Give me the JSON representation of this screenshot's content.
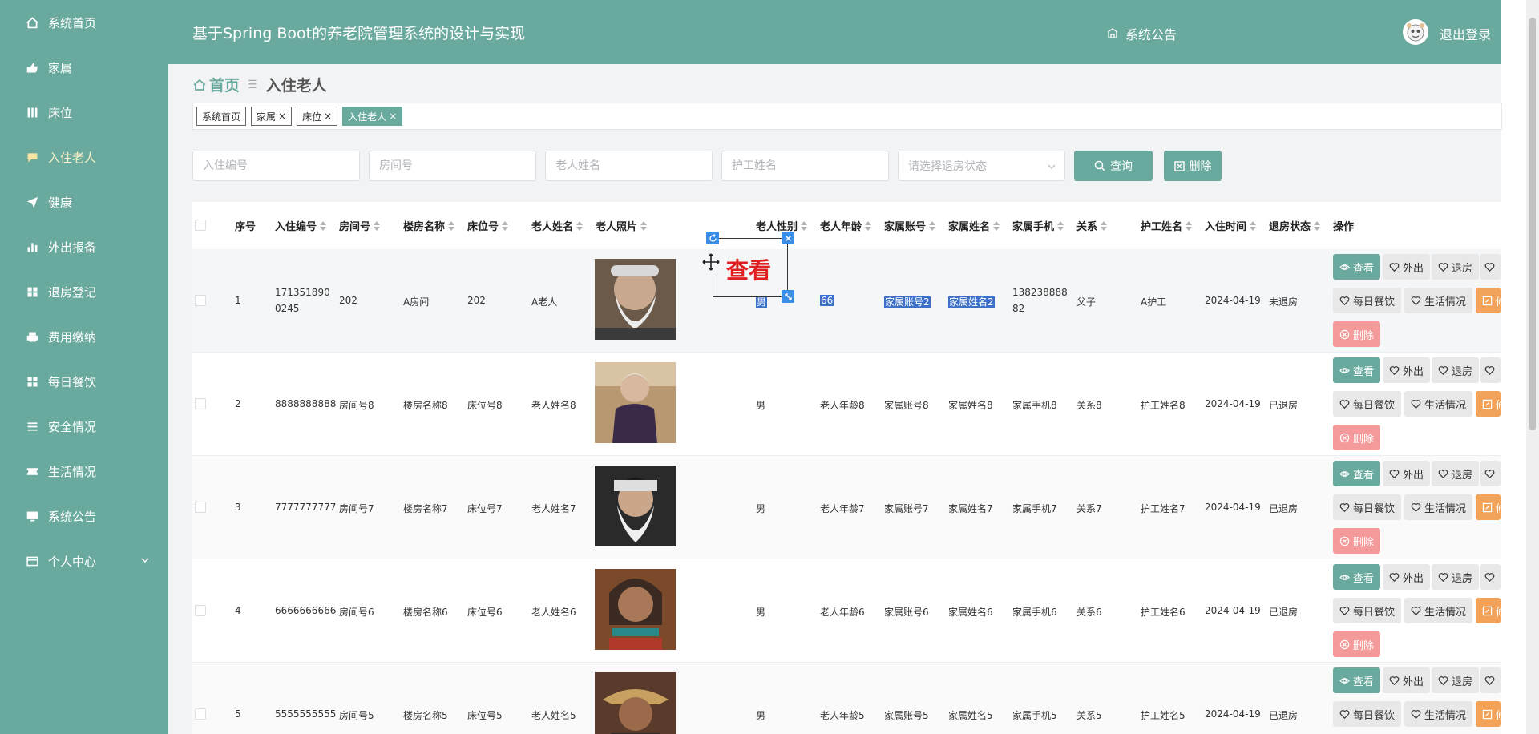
{
  "sidebar": {
    "items": [
      {
        "label": "系统首页",
        "icon": "home-icon"
      },
      {
        "label": "家属",
        "icon": "thumbs-up-icon"
      },
      {
        "label": "床位",
        "icon": "bars-icon"
      },
      {
        "label": "入住老人",
        "icon": "chat-icon"
      },
      {
        "label": "健康",
        "icon": "paper-plane-icon"
      },
      {
        "label": "外出报备",
        "icon": "chart-icon"
      },
      {
        "label": "退房登记",
        "icon": "grid-icon"
      },
      {
        "label": "费用缴纳",
        "icon": "printer-icon"
      },
      {
        "label": "每日餐饮",
        "icon": "grid-icon"
      },
      {
        "label": "安全情况",
        "icon": "list-icon"
      },
      {
        "label": "生活情况",
        "icon": "ticket-icon"
      },
      {
        "label": "系统公告",
        "icon": "monitor-icon"
      },
      {
        "label": "个人中心",
        "icon": "card-icon"
      }
    ]
  },
  "header": {
    "title": "基于Spring Boot的养老院管理系统的设计与实现",
    "notice": "系统公告",
    "logout": "退出登录"
  },
  "breadcrumb": {
    "home": "首页",
    "current": "入住老人"
  },
  "tags": [
    {
      "label": "系统首页",
      "closable": false
    },
    {
      "label": "家属",
      "closable": true
    },
    {
      "label": "床位",
      "closable": true
    },
    {
      "label": "入住老人",
      "closable": true
    }
  ],
  "tag_close": "×",
  "search": {
    "placeholders": [
      "入住编号",
      "房间号",
      "老人姓名",
      "护工姓名"
    ],
    "select_placeholder": "请选择退房状态",
    "query": "查询",
    "delete": "删除"
  },
  "table": {
    "headers": [
      "序号",
      "入住编号",
      "房间号",
      "楼房名称",
      "床位号",
      "老人姓名",
      "老人照片",
      "老人性别",
      "老人年龄",
      "家属账号",
      "家属姓名",
      "家属手机",
      "关系",
      "护工姓名",
      "入住时间",
      "退房状态",
      "操作"
    ],
    "rows": [
      {
        "no": "1",
        "code": "1713518900245",
        "room": "202",
        "building": "A房间",
        "bed": "202",
        "name": "A老人",
        "gender": "男",
        "age": "66",
        "acct": "家属账号2",
        "fname": "家属姓名2",
        "phone": "13823888882",
        "rel": "父子",
        "nurse": "A护工",
        "date": "2024-04-19",
        "status": "未退房"
      },
      {
        "no": "2",
        "code": "8888888888",
        "room": "房间号8",
        "building": "楼房名称8",
        "bed": "床位号8",
        "name": "老人姓名8",
        "gender": "男",
        "age": "老人年龄8",
        "acct": "家属账号8",
        "fname": "家属姓名8",
        "phone": "家属手机8",
        "rel": "关系8",
        "nurse": "护工姓名8",
        "date": "2024-04-19",
        "status": "已退房"
      },
      {
        "no": "3",
        "code": "7777777777",
        "room": "房间号7",
        "building": "楼房名称7",
        "bed": "床位号7",
        "name": "老人姓名7",
        "gender": "男",
        "age": "老人年龄7",
        "acct": "家属账号7",
        "fname": "家属姓名7",
        "phone": "家属手机7",
        "rel": "关系7",
        "nurse": "护工姓名7",
        "date": "2024-04-19",
        "status": "已退房"
      },
      {
        "no": "4",
        "code": "6666666666",
        "room": "房间号6",
        "building": "楼房名称6",
        "bed": "床位号6",
        "name": "老人姓名6",
        "gender": "男",
        "age": "老人年龄6",
        "acct": "家属账号6",
        "fname": "家属姓名6",
        "phone": "家属手机6",
        "rel": "关系6",
        "nurse": "护工姓名6",
        "date": "2024-04-19",
        "status": "已退房"
      },
      {
        "no": "5",
        "code": "5555555555",
        "room": "房间号5",
        "building": "楼房名称5",
        "bed": "床位号5",
        "name": "老人姓名5",
        "gender": "男",
        "age": "老人年龄5",
        "acct": "家属账号5",
        "fname": "家属姓名5",
        "phone": "家属手机5",
        "rel": "关系5",
        "nurse": "护工姓名5",
        "date": "2024-04-19",
        "status": "已退房"
      }
    ]
  },
  "actions": {
    "view": "查看",
    "out": "外出",
    "checkout": "退房",
    "meal": "每日餐饮",
    "life": "生活情况",
    "edit": "修",
    "del": "删除"
  },
  "overlay": {
    "label": "查看"
  },
  "colors": {
    "primary": "#6aaa9e",
    "danger": "#f59a9a",
    "warning": "#f2a359",
    "selection": "#3b6fc8"
  }
}
